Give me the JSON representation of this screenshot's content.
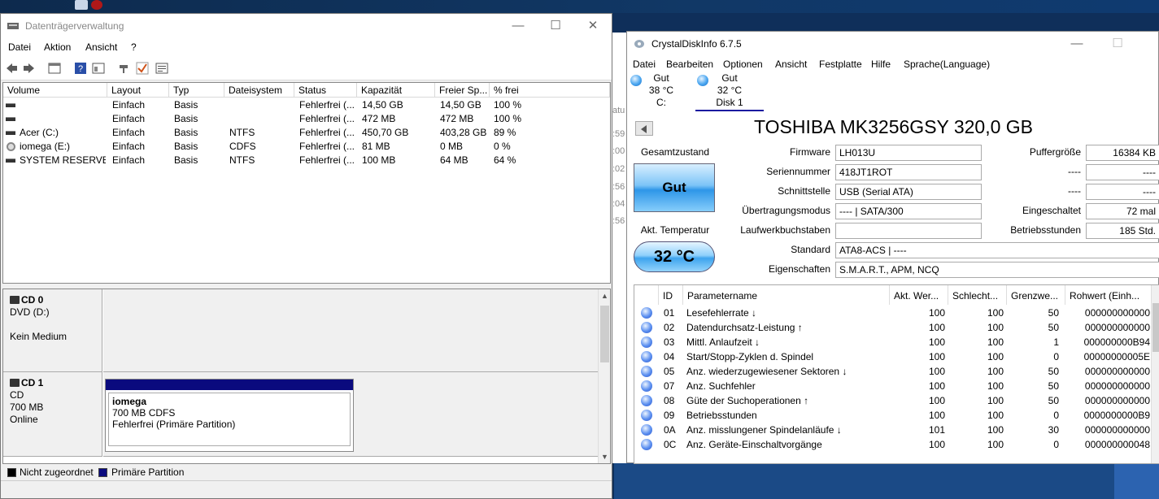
{
  "desktop": {
    "icons": [
      {
        "name": "desktop-shortcut-icon",
        "color": "#c9d6e8"
      },
      {
        "name": "desktop-shortcut-red-icon",
        "color": "#b01818"
      }
    ]
  },
  "disk_management": {
    "title": "Datenträgerverwaltung",
    "window_controls": {
      "minimize": "—",
      "maximize": "☐",
      "close": "✕"
    },
    "menu": [
      "Datei",
      "Aktion",
      "Ansicht",
      "?"
    ],
    "toolbar_icons": [
      "back-arrow-icon",
      "forward-arrow-icon",
      "properties-icon",
      "help-icon",
      "console-tree-icon",
      "connect-icon",
      "check-icon",
      "details-icon"
    ],
    "columns": [
      "Volume",
      "Layout",
      "Typ",
      "Dateisystem",
      "Status",
      "Kapazität",
      "Freier Sp...",
      "% frei"
    ],
    "volumes": [
      {
        "volume": "",
        "layout": "Einfach",
        "typ": "Basis",
        "fs": "",
        "status": "Fehlerfrei (...",
        "kapazitaet": "14,50 GB",
        "frei": "14,50 GB",
        "prozent": "100 %",
        "icon": "drive-icon"
      },
      {
        "volume": "",
        "layout": "Einfach",
        "typ": "Basis",
        "fs": "",
        "status": "Fehlerfrei (...",
        "kapazitaet": "472 MB",
        "frei": "472 MB",
        "prozent": "100 %",
        "icon": "drive-icon"
      },
      {
        "volume": "Acer (C:)",
        "layout": "Einfach",
        "typ": "Basis",
        "fs": "NTFS",
        "status": "Fehlerfrei (...",
        "kapazitaet": "450,70 GB",
        "frei": "403,28 GB",
        "prozent": "89 %",
        "icon": "drive-icon"
      },
      {
        "volume": "iomega (E:)",
        "layout": "Einfach",
        "typ": "Basis",
        "fs": "CDFS",
        "status": "Fehlerfrei (...",
        "kapazitaet": "81 MB",
        "frei": "0 MB",
        "prozent": "0 %",
        "icon": "cd-icon"
      },
      {
        "volume": "SYSTEM RESERVED",
        "layout": "Einfach",
        "typ": "Basis",
        "fs": "NTFS",
        "status": "Fehlerfrei (...",
        "kapazitaet": "100 MB",
        "frei": "64 MB",
        "prozent": "64 %",
        "icon": "drive-icon"
      }
    ],
    "disks": [
      {
        "name": "CD 0",
        "lines": [
          "DVD (D:)",
          "",
          "Kein Medium"
        ]
      },
      {
        "name": "CD 1",
        "lines": [
          "CD",
          "700 MB",
          "Online"
        ],
        "partition": {
          "name": "iomega",
          "size": "700 MB CDFS",
          "status": "Fehlerfrei (Primäre Partition)"
        }
      }
    ],
    "legend": [
      {
        "label": "Nicht zugeordnet",
        "color": "#000000"
      },
      {
        "label": "Primäre Partition",
        "color": "#0a0a7e"
      }
    ]
  },
  "peek_window": {
    "fragments": [
      "atu",
      ":59",
      ":00",
      ":02",
      ":56",
      ":04",
      ":56"
    ]
  },
  "crystaldiskinfo": {
    "title": "CrystalDiskInfo 6.7.5",
    "window_controls": {
      "minimize": "—",
      "maximize": "☐"
    },
    "menu": [
      "Datei",
      "Bearbeiten",
      "Optionen",
      "Ansicht",
      "Festplatte",
      "Hilfe",
      "Sprache(Language)"
    ],
    "disks": [
      {
        "status": "Gut",
        "temp": "38 °C",
        "label": "C:"
      },
      {
        "status": "Gut",
        "temp": "32 °C",
        "label": "Disk 1"
      }
    ],
    "model": "TOSHIBA MK3256GSY 320,0 GB",
    "gesamtzustand_label": "Gesamtzustand",
    "health": "Gut",
    "temp_label": "Akt. Temperatur",
    "temperature": "32 °C",
    "fields": [
      {
        "label": "Firmware",
        "value": "LH013U"
      },
      {
        "label": "Seriennummer",
        "value": "418JT1ROT"
      },
      {
        "label": "Schnittstelle",
        "value": "USB (Serial ATA)"
      },
      {
        "label": "Übertragungsmodus",
        "value": "---- | SATA/300"
      },
      {
        "label": "Laufwerkbuchstaben",
        "value": ""
      },
      {
        "label": "Standard",
        "value": "ATA8-ACS | ----"
      },
      {
        "label": "Eigenschaften",
        "value": "S.M.A.R.T., APM, NCQ"
      }
    ],
    "right_fields": [
      {
        "label": "Puffergröße",
        "value": "16384 KB"
      },
      {
        "label": "----",
        "value": "----"
      },
      {
        "label": "----",
        "value": "----"
      },
      {
        "label": "Eingeschaltet",
        "value": "72 mal"
      },
      {
        "label": "Betriebsstunden",
        "value": "185 Std."
      }
    ],
    "smart_columns": [
      "ID",
      "Parametername",
      "Akt. Wer...",
      "Schlecht...",
      "Grenzwe...",
      "Rohwert (Einh..."
    ],
    "smart_rows": [
      {
        "id": "01",
        "name": "Lesefehlerrate ↓",
        "akt": "100",
        "schlecht": "100",
        "grenz": "50",
        "roh": "000000000000"
      },
      {
        "id": "02",
        "name": "Datendurchsatz-Leistung ↑",
        "akt": "100",
        "schlecht": "100",
        "grenz": "50",
        "roh": "000000000000"
      },
      {
        "id": "03",
        "name": "Mittl. Anlaufzeit ↓",
        "akt": "100",
        "schlecht": "100",
        "grenz": "1",
        "roh": "000000000B94"
      },
      {
        "id": "04",
        "name": "Start/Stopp-Zyklen d. Spindel",
        "akt": "100",
        "schlecht": "100",
        "grenz": "0",
        "roh": "00000000005E"
      },
      {
        "id": "05",
        "name": "Anz. wiederzugewiesener Sektoren ↓",
        "akt": "100",
        "schlecht": "100",
        "grenz": "50",
        "roh": "000000000000"
      },
      {
        "id": "07",
        "name": "Anz. Suchfehler",
        "akt": "100",
        "schlecht": "100",
        "grenz": "50",
        "roh": "000000000000"
      },
      {
        "id": "08",
        "name": "Güte der Suchoperationen ↑",
        "akt": "100",
        "schlecht": "100",
        "grenz": "50",
        "roh": "000000000000"
      },
      {
        "id": "09",
        "name": "Betriebsstunden",
        "akt": "100",
        "schlecht": "100",
        "grenz": "0",
        "roh": "0000000000B9"
      },
      {
        "id": "0A",
        "name": "Anz. misslungener Spindelanläufe ↓",
        "akt": "101",
        "schlecht": "100",
        "grenz": "30",
        "roh": "000000000000"
      },
      {
        "id": "0C",
        "name": "Anz. Geräte-Einschaltvorgänge",
        "akt": "100",
        "schlecht": "100",
        "grenz": "0",
        "roh": "000000000048"
      }
    ]
  }
}
